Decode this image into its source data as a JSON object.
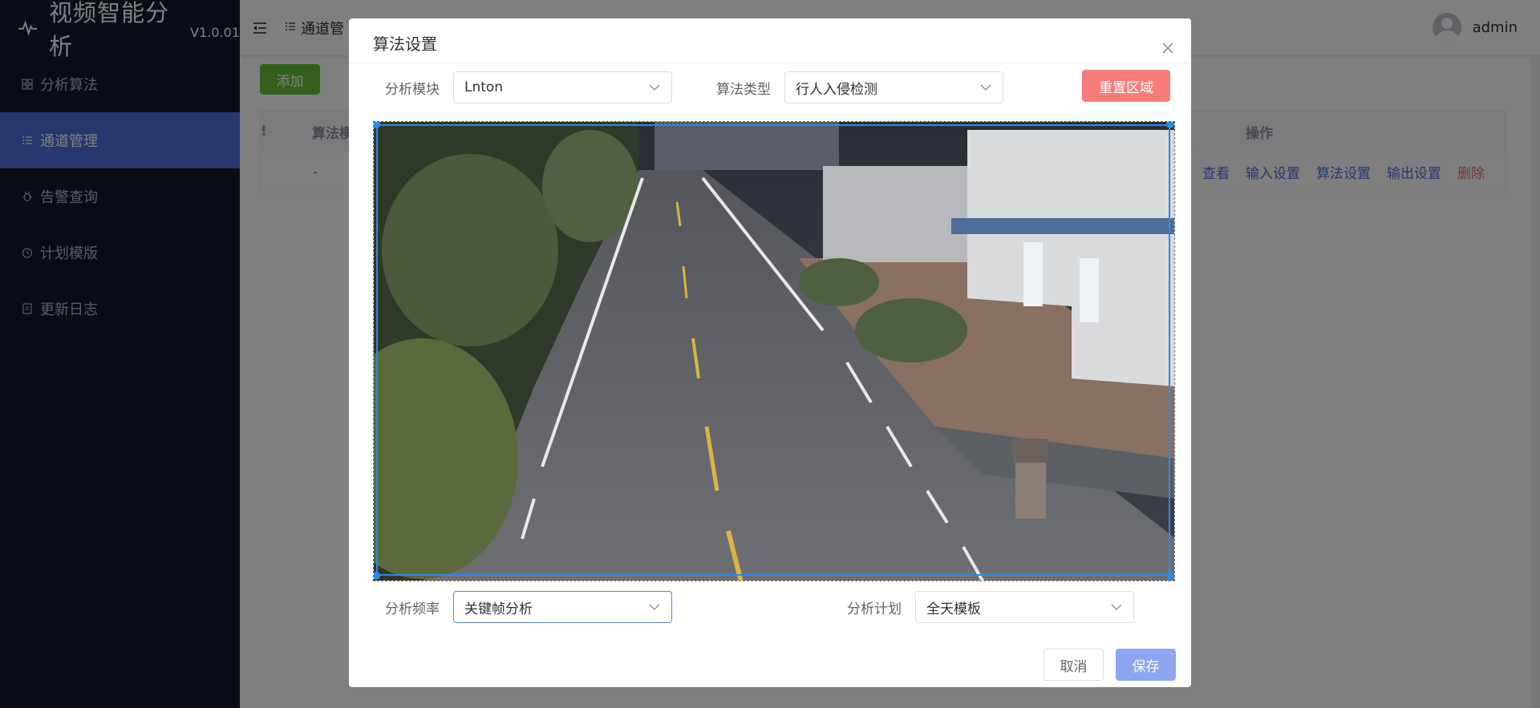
{
  "app": {
    "title": "视频智能分析",
    "version": "V1.0.01"
  },
  "sidebar": {
    "items": [
      {
        "label": "分析算法",
        "icon": "grid-icon",
        "active": false
      },
      {
        "label": "通道管理",
        "icon": "list-icon",
        "active": true
      },
      {
        "label": "告警查询",
        "icon": "bug-icon",
        "active": false
      },
      {
        "label": "计划模版",
        "icon": "clock-icon",
        "active": false
      },
      {
        "label": "更新日志",
        "icon": "document-icon",
        "active": false
      }
    ]
  },
  "header": {
    "breadcrumb": "通道管",
    "user": "admin"
  },
  "toolbar": {
    "add_label": "添加"
  },
  "table": {
    "headers": {
      "first_col_fragment": "!",
      "algo": "算法模",
      "operations": "操作"
    },
    "rows": [
      {
        "algo": "-",
        "actions": [
          "查看",
          "输入设置",
          "算法设置",
          "输出设置",
          "删除"
        ]
      }
    ]
  },
  "dialog": {
    "title": "算法设置",
    "module_label": "分析模块",
    "module_value": "Lnton",
    "algo_type_label": "算法类型",
    "algo_type_value": "行人入侵检测",
    "reset_label": "重置区域",
    "frequency_label": "分析频率",
    "frequency_value": "关键帧分析",
    "plan_label": "分析计划",
    "plan_value": "全天模板",
    "cancel_label": "取消",
    "save_label": "保存"
  },
  "colors": {
    "sidebar_bg": "#161b2c",
    "active_menu": "#5070dc",
    "add_button": "#67c23a",
    "reset_button": "#f67c7c",
    "save_button": "#8ea6f2",
    "region_line": "#2b8ae8",
    "danger_text": "#f56c6c",
    "link_text": "#5070dc"
  }
}
